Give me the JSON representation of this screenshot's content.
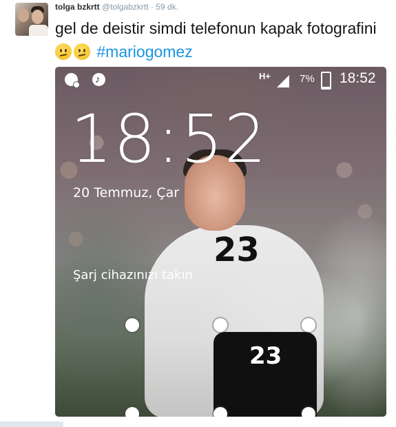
{
  "tweet": {
    "user_name": "tolga bzkrtt",
    "handle": "@tolgabzkrtt",
    "separator": "·",
    "time": "59 dk.",
    "text": "gel de deistir simdi telefonun kapak fotografini",
    "hashtag": "#mariogomez",
    "emoji": [
      "confused-face",
      "confused-face"
    ]
  },
  "lockscreen": {
    "status_bar": {
      "network": "H+",
      "battery_percent": "7%",
      "time": "18:52",
      "icons": [
        "notification-icon",
        "music-icon",
        "signal-icon",
        "battery-icon"
      ]
    },
    "clock": "18:52",
    "date": "20 Temmuz, Çar",
    "charge_message": "Şarj cihazınızı takın",
    "wallpaper": {
      "shirt_number": "23",
      "shorts_number": "23"
    }
  },
  "colors": {
    "hashtag": "#1b95e0",
    "username": "#292f33",
    "meta": "#8899a6"
  }
}
